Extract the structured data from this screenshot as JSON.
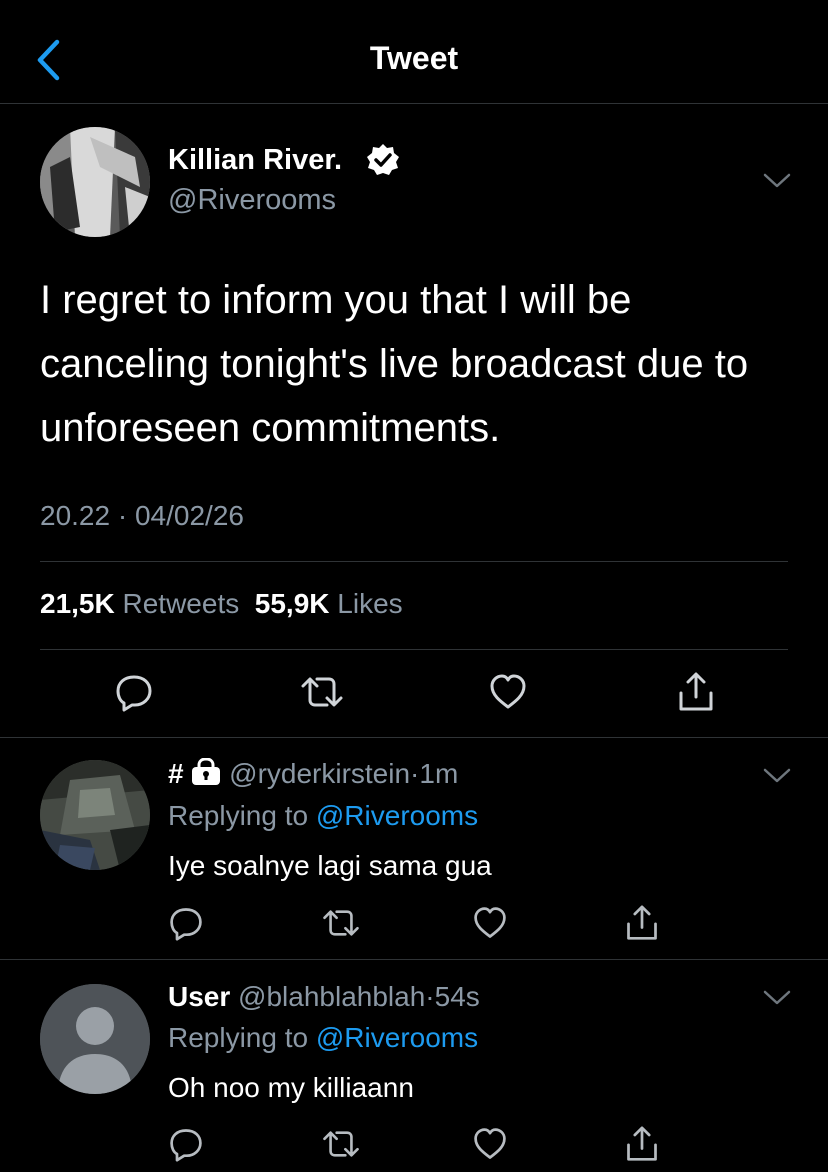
{
  "header": {
    "title": "Tweet",
    "back_icon": "chevron-left-icon",
    "accent_color": "#1d9bf0"
  },
  "tweet": {
    "display_name": "Killian River.",
    "handle": "@Riverooms",
    "verified": true,
    "text": "I regret to inform you that I will be canceling tonight's live broadcast due to unforeseen commitments.",
    "time": "20.22",
    "separator": "·",
    "date": "04/02/26",
    "retweets_count": "21,5K",
    "retweets_label": "Retweets",
    "likes_count": "55,9K",
    "likes_label": "Likes",
    "actions": [
      "reply-icon",
      "retweet-icon",
      "like-icon",
      "share-icon"
    ]
  },
  "replies": [
    {
      "name_prefix": "#",
      "locked": true,
      "handle": "@ryderkirstein",
      "separator": "·",
      "time": "1m",
      "replying_label": "Replying to",
      "replying_handle": "@Riverooms",
      "text": "Iye soalnye lagi sama gua"
    },
    {
      "display_name": "User",
      "handle": "@blahblahblah",
      "separator": "·",
      "time": "54s",
      "replying_label": "Replying to",
      "replying_handle": "@Riverooms",
      "text": "Oh noo my killiaann"
    }
  ],
  "colors": {
    "background": "#000000",
    "text_primary": "#ffffff",
    "text_secondary": "#8b98a5",
    "divider": "#2f3336",
    "link": "#1d9bf0"
  }
}
